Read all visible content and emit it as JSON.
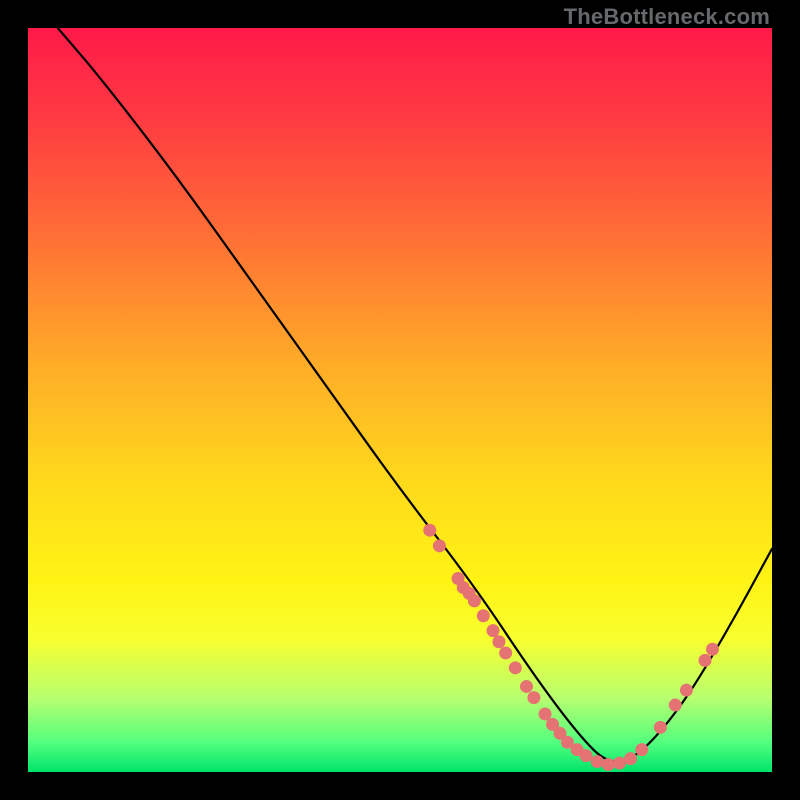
{
  "watermark": "TheBottleneck.com",
  "chart_data": {
    "type": "line",
    "title": "",
    "xlabel": "",
    "ylabel": "",
    "xlim": [
      0,
      100
    ],
    "ylim": [
      0,
      100
    ],
    "grid": false,
    "legend": false,
    "series": [
      {
        "name": "bottleneck-curve",
        "color": "#000000",
        "x": [
          4,
          10,
          20,
          30,
          40,
          50,
          60,
          68,
          74,
          78,
          82,
          88,
          94,
          100
        ],
        "y": [
          100,
          93,
          80,
          66,
          52,
          38,
          25,
          13,
          5,
          1,
          2,
          9,
          19,
          30
        ]
      }
    ],
    "markers": {
      "name": "highlight-segments",
      "color": "#e57373",
      "points": [
        {
          "x": 54.0,
          "y": 32.5
        },
        {
          "x": 55.3,
          "y": 30.4
        },
        {
          "x": 57.8,
          "y": 26.0
        },
        {
          "x": 58.5,
          "y": 24.8
        },
        {
          "x": 59.3,
          "y": 24.0
        },
        {
          "x": 60.0,
          "y": 23.0
        },
        {
          "x": 61.2,
          "y": 21.0
        },
        {
          "x": 62.5,
          "y": 19.0
        },
        {
          "x": 63.3,
          "y": 17.5
        },
        {
          "x": 64.2,
          "y": 16.0
        },
        {
          "x": 65.5,
          "y": 14.0
        },
        {
          "x": 67.0,
          "y": 11.5
        },
        {
          "x": 68.0,
          "y": 10.0
        },
        {
          "x": 69.5,
          "y": 7.8
        },
        {
          "x": 70.5,
          "y": 6.4
        },
        {
          "x": 71.5,
          "y": 5.2
        },
        {
          "x": 72.5,
          "y": 4.0
        },
        {
          "x": 73.8,
          "y": 3.0
        },
        {
          "x": 75.0,
          "y": 2.2
        },
        {
          "x": 76.5,
          "y": 1.4
        },
        {
          "x": 78.0,
          "y": 1.0
        },
        {
          "x": 79.5,
          "y": 1.2
        },
        {
          "x": 81.0,
          "y": 1.8
        },
        {
          "x": 82.5,
          "y": 3.0
        },
        {
          "x": 85.0,
          "y": 6.0
        },
        {
          "x": 87.0,
          "y": 9.0
        },
        {
          "x": 88.5,
          "y": 11.0
        },
        {
          "x": 91.0,
          "y": 15.0
        },
        {
          "x": 92.0,
          "y": 16.5
        }
      ]
    }
  },
  "colors": {
    "curve": "#000000",
    "marker": "#e57373",
    "gradient_top": "#ff1a49",
    "gradient_bottom": "#00e46a",
    "background": "#000000",
    "watermark": "#66696b"
  }
}
